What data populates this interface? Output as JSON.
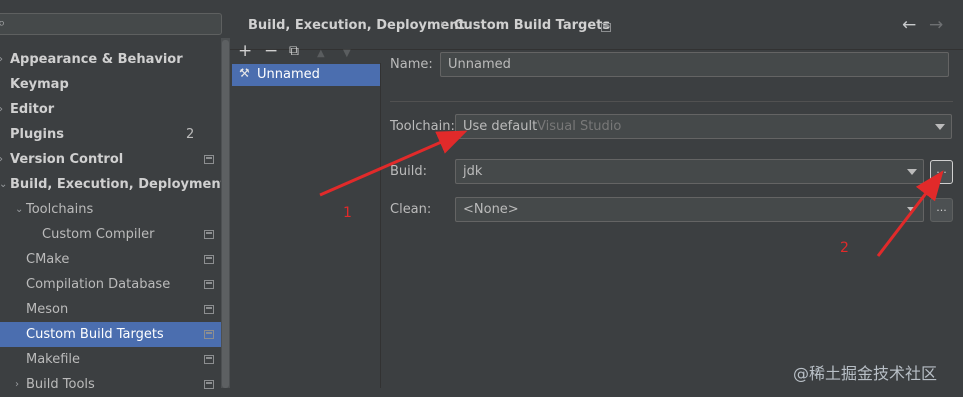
{
  "search": {
    "icon": "search-icon",
    "value": ""
  },
  "tree": [
    {
      "label": "Appearance & Behavior",
      "bold": true,
      "arrow": "›"
    },
    {
      "label": "Keymap",
      "bold": true
    },
    {
      "label": "Editor",
      "bold": true,
      "arrow": "›"
    },
    {
      "label": "Plugins",
      "bold": true,
      "badge": "2"
    },
    {
      "label": "Version Control",
      "bold": true,
      "arrow": "›"
    },
    {
      "label": "Build, Execution, Deployment",
      "bold": true,
      "arrow": "⌄"
    },
    {
      "label": "Toolchains",
      "arrow": "⌄"
    },
    {
      "label": "Custom Compiler"
    },
    {
      "label": "CMake"
    },
    {
      "label": "Compilation Database"
    },
    {
      "label": "Meson"
    },
    {
      "label": "Custom Build Targets",
      "selected": true
    },
    {
      "label": "Makefile"
    },
    {
      "label": "Build Tools",
      "arrow": "›"
    }
  ],
  "header": {
    "crumb1": "Build, Execution, Deployment",
    "sep": "›",
    "crumb2": "Custom Build Targets",
    "back": "←",
    "forward": "→"
  },
  "list_toolbar": {
    "add": "+",
    "remove": "−",
    "copy": "⧉",
    "up": "▲",
    "down": "▼"
  },
  "targets": [
    {
      "label": "Unnamed",
      "icon": "build-target-icon"
    }
  ],
  "form": {
    "name_label": "Name:",
    "name_value": "Unnamed",
    "toolchain_label": "Toolchain:",
    "toolchain_value": "Use default",
    "toolchain_hint": "Visual Studio",
    "build_label": "Build:",
    "build_value": "jdk",
    "clean_label": "Clean:",
    "clean_value": "<None>",
    "ellipsis": "..."
  },
  "annotations": {
    "n1": "1",
    "n2": "2",
    "color": "#e12a2a"
  },
  "watermark": "@稀土掘金技术社区",
  "colors": {
    "selection": "#4b6eaf",
    "background": "#3c3f41"
  }
}
